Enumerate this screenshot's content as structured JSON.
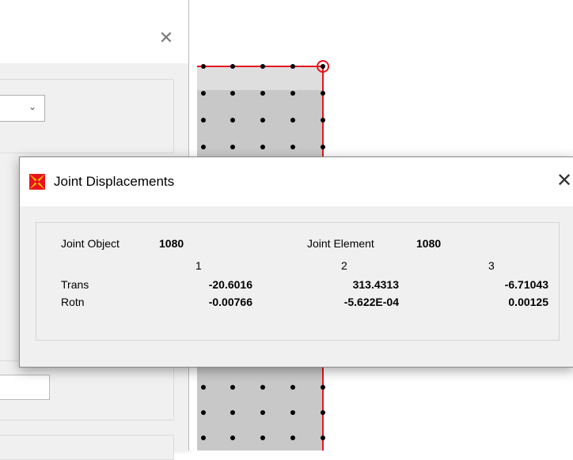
{
  "window": {
    "title": "Joint Displacements",
    "close_glyph": "✕"
  },
  "joint": {
    "object_label": "Joint  Object",
    "object_value": "1080",
    "element_label": "Joint Element",
    "element_value": "1080"
  },
  "table": {
    "columns": [
      "1",
      "2",
      "3"
    ],
    "rows": [
      {
        "label": "Trans",
        "values": [
          "-20.6016",
          "313.4313",
          "-6.71043"
        ]
      },
      {
        "label": "Rotn",
        "values": [
          "-0.00766",
          "-5.622E-04",
          "0.00125"
        ]
      }
    ]
  },
  "background_dialog": {
    "close_glyph": "✕",
    "combo_arrow": "⌄"
  },
  "colors": {
    "accent_red": "#e8141c",
    "icon_yellow": "#f5c400",
    "grid_shade": "#c8c8c8"
  },
  "icons": [
    "app-icon",
    "close-icon",
    "chevron-down-icon"
  ]
}
